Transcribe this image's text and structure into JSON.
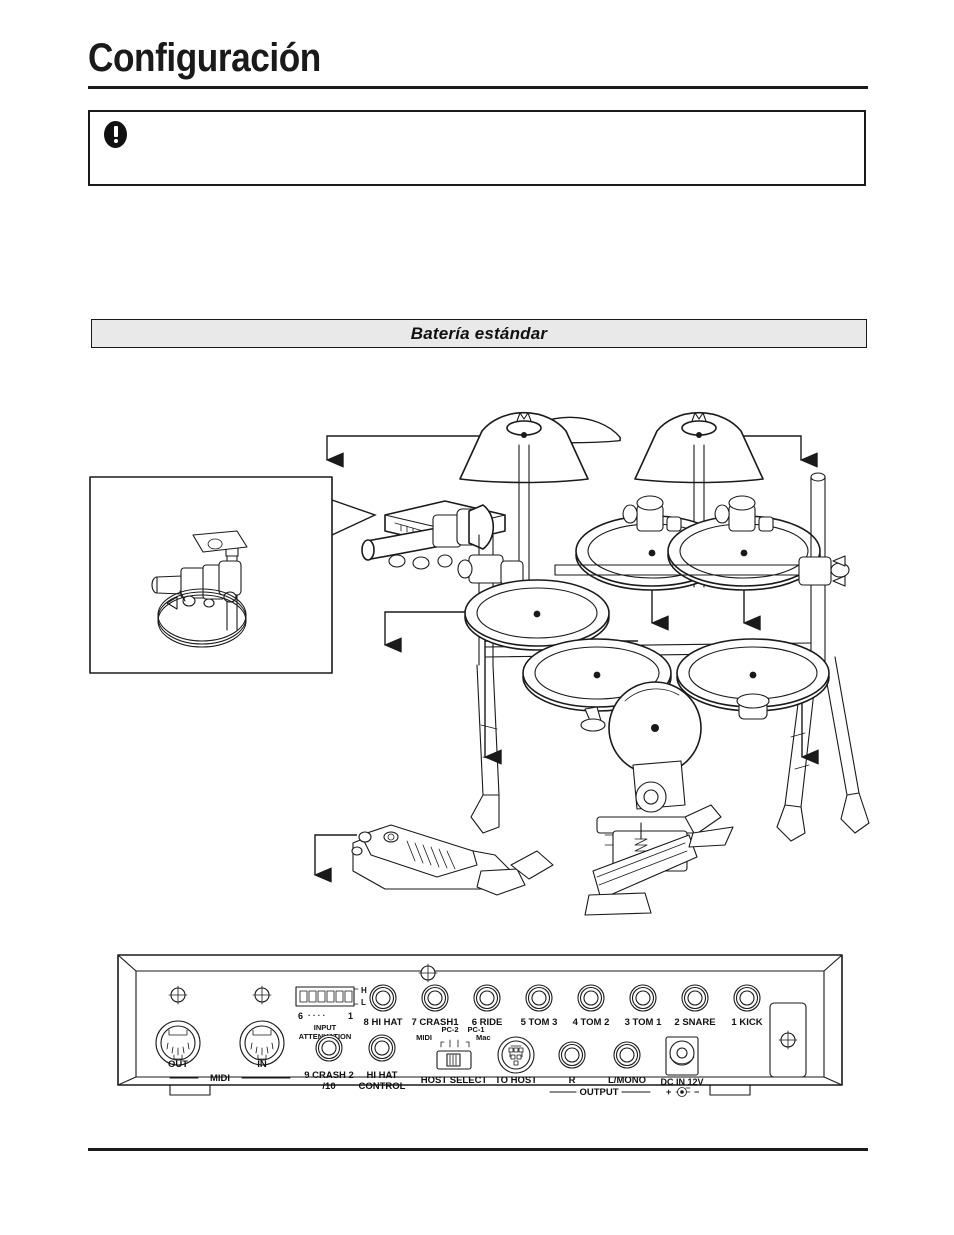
{
  "page": {
    "title": "Configuración",
    "note": {
      "icon": "exclamation-circle-icon",
      "text": ""
    },
    "section": {
      "label": "Batería estándar"
    }
  },
  "kit_figure": {
    "name": "standard-drum-kit-diagram",
    "callout_box": {
      "label": "",
      "detail": "clamp-mount-detail"
    },
    "callouts": [
      {
        "id": "crash2-cymbal-pad",
        "side": "left"
      },
      {
        "id": "crash1-cymbal-pad",
        "side": "right"
      },
      {
        "id": "drum-module",
        "side": "left"
      },
      {
        "id": "tom2-pad",
        "side": "down"
      },
      {
        "id": "tom1-pad",
        "side": "down"
      },
      {
        "id": "tom3-pad",
        "side": "left"
      },
      {
        "id": "snare-pad",
        "side": "left"
      },
      {
        "id": "ride-cymbal-pad",
        "side": "right"
      },
      {
        "id": "kick-trigger-pad",
        "side": "left"
      },
      {
        "id": "hi-hat-control-pedal",
        "side": "left"
      }
    ]
  },
  "rear_panel": {
    "name": "drum-module-rear-panel",
    "attenuation": {
      "title_line1": "INPUT",
      "title_line2": "ATTENUATION",
      "high_label": "H",
      "low_label": "L",
      "scale_left": "6",
      "scale_dots": "· · · ·",
      "scale_right": "1",
      "switch_count": 6
    },
    "midi": {
      "group_label": "MIDI",
      "out_label": "OUT",
      "in_label": "IN"
    },
    "host_select": {
      "label": "HOST SELECT",
      "positions": [
        "MIDI",
        "PC-2",
        "PC-1",
        "Mac"
      ],
      "to_host_label": "TO HOST"
    },
    "output": {
      "group_label": "OUTPUT",
      "right_label": "R",
      "left_label": "L/MONO"
    },
    "power": {
      "label": "DC IN 12V",
      "polarity_plus": "+",
      "polarity_minus": "−"
    },
    "trigger_inputs_top": [
      "8  HI HAT",
      "7  CRASH1",
      "6  RIDE",
      "5  TOM 3",
      "4  TOM 2",
      "3  TOM 1",
      "2  SNARE",
      "1  KICK"
    ],
    "trigger_inputs_bottom": [
      {
        "line1": "9  CRASH 2",
        "line2": "/10"
      },
      {
        "line1": "HI HAT",
        "line2": "CONTROL"
      }
    ]
  },
  "colors": {
    "ink": "#1a1a1a",
    "paper": "#ffffff",
    "banner_fill": "#e9e9e9"
  }
}
